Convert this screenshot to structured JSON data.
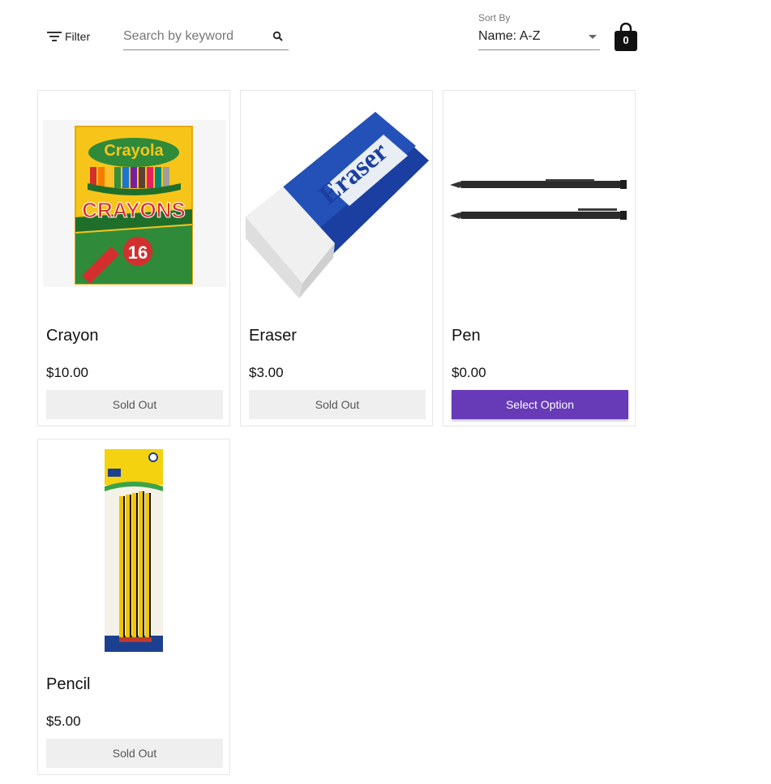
{
  "toolbar": {
    "filter_label": "Filter",
    "search_placeholder": "Search by keyword",
    "search_value": "",
    "sort_label": "Sort By",
    "sort_value": "Name: A-Z",
    "cart_count": "0"
  },
  "colors": {
    "accent": "#673ab7",
    "sold_out_bg": "#efefef"
  },
  "products": [
    {
      "name": "Crayon",
      "price": "$10.00",
      "button": "Sold Out",
      "image": "crayola-crayons-box",
      "image_text": [
        "Crayola",
        "CRAYONS",
        "16"
      ]
    },
    {
      "name": "Eraser",
      "price": "$3.00",
      "button": "Sold Out",
      "image": "eraser-block",
      "image_text": [
        "Eraser"
      ]
    },
    {
      "name": "Pen",
      "price": "$0.00",
      "button": "Select Option",
      "image": "black-pens"
    },
    {
      "name": "Pencil",
      "price": "$5.00",
      "button": "Sold Out",
      "image": "pencil-pack"
    }
  ]
}
